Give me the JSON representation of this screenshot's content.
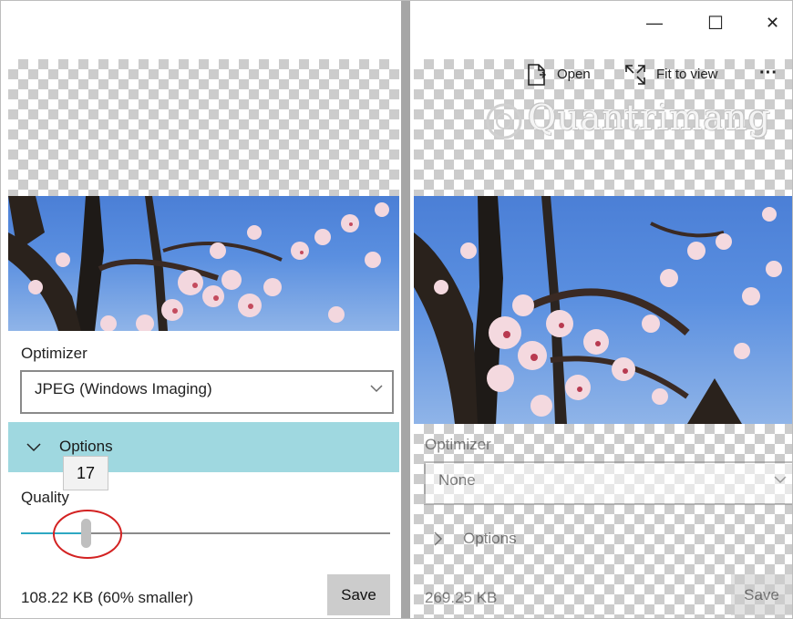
{
  "window": {
    "controls": {
      "minimize_glyph": "—",
      "maximize_glyph": "☐",
      "close_glyph": "✕"
    }
  },
  "toolbar": {
    "open_label": "Open",
    "fit_label": "Fit to view",
    "more_glyph": "···"
  },
  "watermark": {
    "text": "Quantrimang"
  },
  "left": {
    "optimizer_label": "Optimizer",
    "optimizer_value": "JPEG (Windows Imaging)",
    "options_label": "Options",
    "options_expanded": true,
    "quality_label": "Quality",
    "quality_value": "17",
    "quality_fraction": 0.17,
    "status": "108.22 KB (60% smaller)",
    "save_label": "Save"
  },
  "right": {
    "optimizer_label": "Optimizer",
    "optimizer_value": "None",
    "options_label": "Options",
    "options_expanded": false,
    "status": "269.25 KB",
    "save_label": "Save"
  },
  "colors": {
    "accent": "#9fd8e0",
    "slider_fill": "#2ea8c2",
    "highlight": "#d32222"
  },
  "icons": [
    "open-file-icon",
    "fit-to-view-icon",
    "chevron-down-icon",
    "chevron-right-icon",
    "more-icon"
  ]
}
